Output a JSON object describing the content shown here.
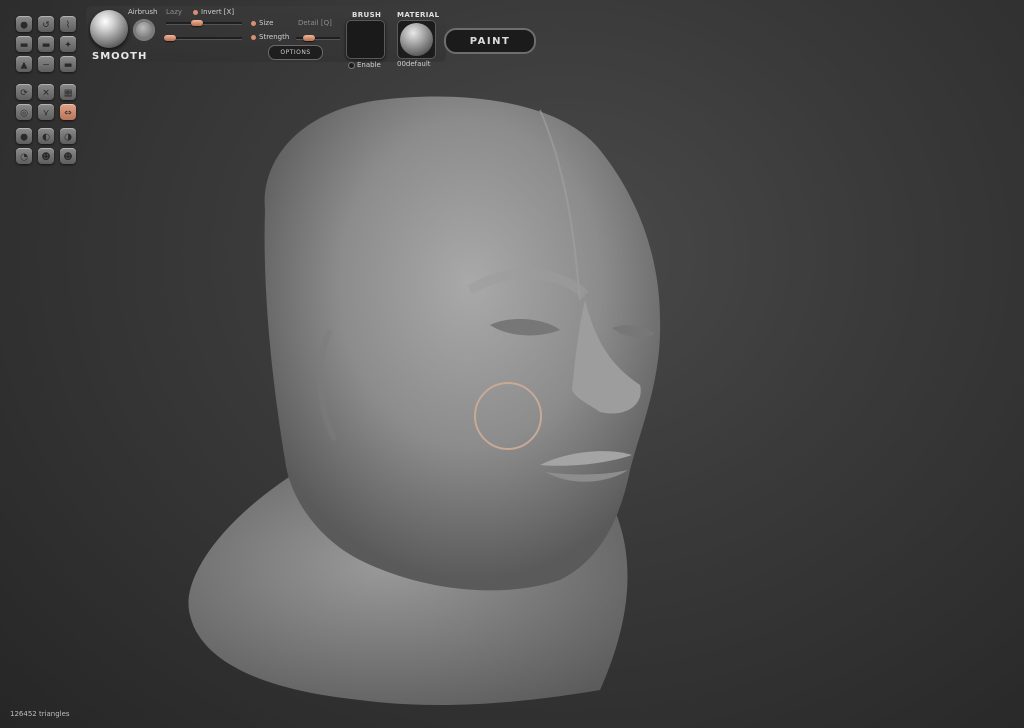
{
  "brush": {
    "name": "SMOOTH",
    "airbrush_label": "Airbrush",
    "lazy_label": "Lazy",
    "invert_label": "Invert [X]",
    "size_label": "Size",
    "detail_label": "Detail [Q]",
    "strength_label": "Strength",
    "options_label": "OPTIONS"
  },
  "brush_panel": {
    "title": "BRUSH",
    "enable_label": "Enable"
  },
  "material_panel": {
    "title": "MATERIAL",
    "name": "00default"
  },
  "paint_button": {
    "label": "PAINT"
  },
  "status": {
    "triangles": "126452 triangles"
  },
  "tools": [
    "grab-tool-icon",
    "rotate-tool-icon",
    "pinch-tool-icon",
    "flatten-tool-icon",
    "inflate-tool-icon",
    "crease-tool-icon",
    "clay-tool-icon",
    "smooth-tool-icon",
    "layer-tool-icon",
    "symmetry-icon",
    "wireframe-icon",
    "grid-icon",
    "reset-view-icon",
    "mirror-icon",
    "stroke-mode-icon",
    "sphere-icon",
    "mask-icon",
    "mask-invert-icon",
    "undo-icon",
    "head-icon",
    "body-icon"
  ],
  "colors": {
    "accent": "#d98f6f",
    "active_tool": "#c88566"
  }
}
